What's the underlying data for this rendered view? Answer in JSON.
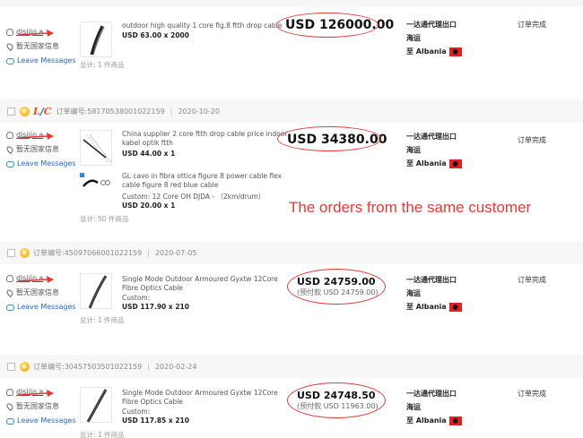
{
  "orders": [
    {
      "header": null,
      "buyer": {
        "name": "disiijo.a",
        "country": "暂无国家信息",
        "message": "Leave Messages"
      },
      "products": [
        {
          "title": "outdoor high quality 1 core fig.8 ftth drop cable",
          "qty": "USD 63.00 x 2000"
        }
      ],
      "total": "总计: 1 件商品",
      "price": "USD 126000.00",
      "ship": {
        "agent": "一达通代理出口",
        "method": "海运",
        "to": "至 Albania"
      },
      "status": "订单完成"
    },
    {
      "header": {
        "order_no": "订单编号:58170538001022159",
        "date": "2020-10-20"
      },
      "buyer": {
        "name": "disiijo.a",
        "country": "暂无国家信息",
        "message": "Leave Messages"
      },
      "products": [
        {
          "title": "China supplier 2 core ftth drop cable price indoor kabel optik ftth",
          "qty": "USD 44.00 x 1"
        },
        {
          "title": "GL cavo in fibra ottica figure 8 power cable flex cable figure 8 red blue cable",
          "custom": "Custom: 12 Core OH DJDA - （2km/drum）",
          "qty": "USD 20.00 x 1"
        }
      ],
      "total": "总计: 50 件商品",
      "price": "USD 34380.00",
      "ship": {
        "agent": "一达通代理出口",
        "method": "海运",
        "to": "至 Albania"
      },
      "status": "订单完成"
    },
    {
      "header": {
        "order_no": "订单编号:45097066001022159",
        "date": "2020-07-05"
      },
      "buyer": {
        "name": "disiijo.a",
        "country": "暂无国家信息",
        "message": "Leave Messages"
      },
      "products": [
        {
          "title": "Single Mode Outdoor Armoured Gyxtw 12Core Fibre Optics Cable",
          "custom": "Custom:",
          "qty": "USD 117.90 x 210"
        }
      ],
      "total": "总计: 1 件商品",
      "price": "USD 24759.00",
      "prepay": "(预付款 USD 24759.00)",
      "ship": {
        "agent": "一达通代理出口",
        "method": "海运",
        "to": "至 Albania"
      },
      "status": "订单完成"
    },
    {
      "header": {
        "order_no": "订单编号:30457503501022159",
        "date": "2020-02-24"
      },
      "buyer": {
        "name": "disiijo.a",
        "country": "暂无国家信息",
        "message": "Leave Messages"
      },
      "products": [
        {
          "title": "Single Mode Outdoor Armoured Gyxtw 12Core Fibre Optics Cable",
          "custom": "Custom:",
          "qty": "USD 117.85 x 210"
        }
      ],
      "total": "总计: 1 件商品",
      "price": "USD 24748.50",
      "prepay": "(预付款 USD 11963.00)",
      "ship": {
        "agent": "一达通代理出口",
        "method": "海运",
        "to": "至 Albania"
      },
      "status": "订单完成"
    }
  ],
  "annotation": "The orders from the same customer",
  "colors": {
    "accent_red": "#e53935",
    "link_blue": "#2b66c4"
  }
}
